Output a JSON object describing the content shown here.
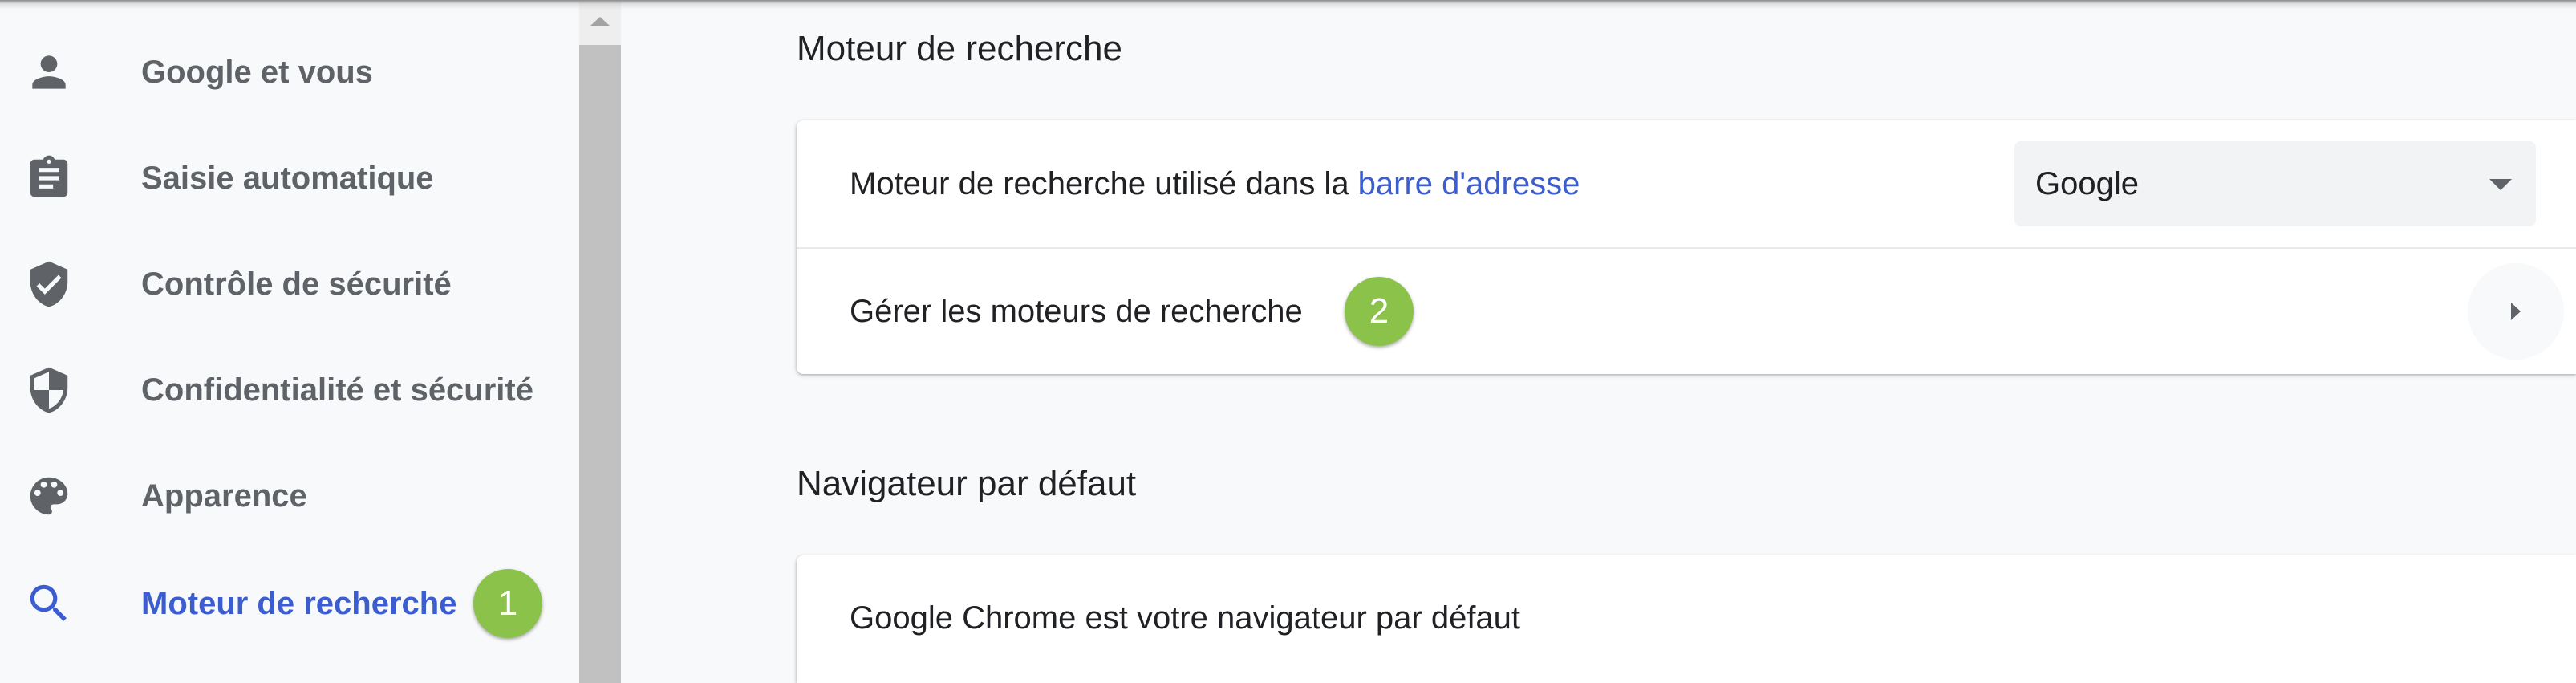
{
  "sidebar": {
    "items": [
      {
        "label": "Google et vous",
        "icon": "person-icon"
      },
      {
        "label": "Saisie automatique",
        "icon": "clipboard-icon"
      },
      {
        "label": "Contrôle de sécurité",
        "icon": "shield-check-icon"
      },
      {
        "label": "Confidentialité et sécurité",
        "icon": "shield-half-icon"
      },
      {
        "label": "Apparence",
        "icon": "palette-icon"
      },
      {
        "label": "Moteur de recherche",
        "icon": "search-icon",
        "active": true,
        "badge": "1"
      }
    ]
  },
  "search_engine": {
    "title": "Moteur de recherche",
    "address_bar_label": "Moteur de recherche utilisé dans la ",
    "address_bar_link": "barre d'adresse",
    "engine_selected": "Google",
    "manage_label": "Gérer les moteurs de recherche",
    "manage_badge": "2"
  },
  "default_browser": {
    "title": "Navigateur par défaut",
    "status": "Google Chrome est votre navigateur par défaut"
  },
  "colors": {
    "accent": "#3c5dd0",
    "badge": "#8bc34a",
    "text": "#202124",
    "nav_text": "#5f6368",
    "background": "#f8f9fa"
  }
}
